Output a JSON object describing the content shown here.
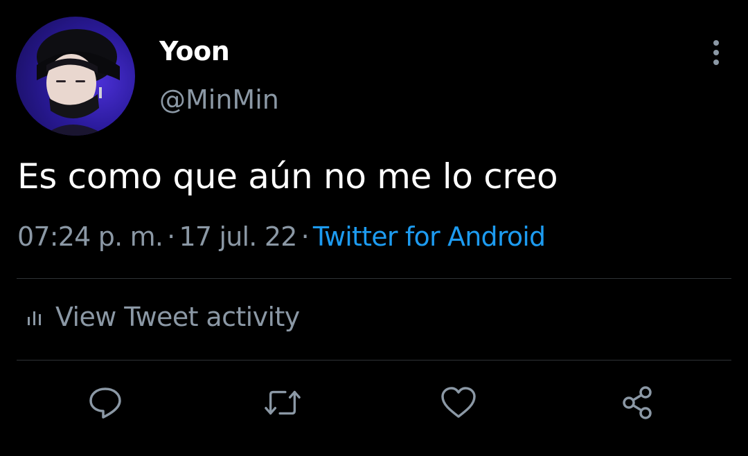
{
  "profile": {
    "display_name": "Yoon",
    "handle": "@MinMin",
    "avatar_icon": "profile-photo"
  },
  "tweet": {
    "text": "Es como que aún no me lo creo",
    "time": "07:24 p. m.",
    "separator": "·",
    "date": "17 jul. 22",
    "source": "Twitter for Android"
  },
  "activity": {
    "label": "View Tweet activity",
    "icon": "bar-chart-icon"
  },
  "actions": {
    "reply_icon": "reply-icon",
    "retweet_icon": "retweet-icon",
    "like_icon": "heart-icon",
    "share_icon": "share-icon",
    "more_icon": "more-vertical-icon"
  },
  "colors": {
    "background": "#000000",
    "primary_text": "#ffffff",
    "secondary_text": "#8b98a5",
    "link": "#1d9bf0",
    "divider": "#2f3336"
  }
}
